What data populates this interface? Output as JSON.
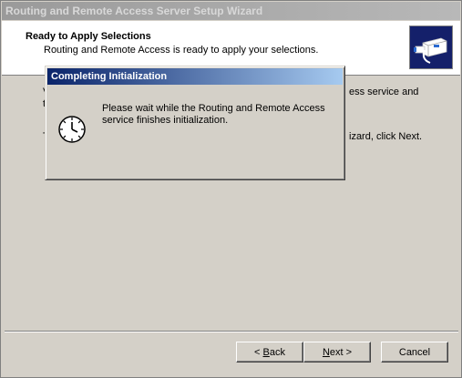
{
  "wizard": {
    "title": "Routing and Remote Access Server Setup Wizard",
    "header_title": "Ready to Apply Selections",
    "header_subtitle": "Routing and Remote Access is ready to apply your selections.",
    "body_fragments": [
      {
        "text": "V"
      },
      {
        "text": "t"
      },
      {
        "text": "T"
      },
      {
        "text": "ess service and"
      },
      {
        "text": "izard, click Next."
      }
    ],
    "buttons": {
      "back": {
        "acc": "B",
        "rest": "ack",
        "prefix": "< "
      },
      "next": {
        "acc": "N",
        "rest": "ext >"
      },
      "cancel": "Cancel"
    }
  },
  "popup": {
    "title": "Completing Initialization",
    "message": "Please wait while the Routing and Remote Access service finishes initialization."
  },
  "icons": {
    "wizard_icon": "network-cable-icon",
    "popup_icon": "clock-icon"
  },
  "colors": {
    "dialog_face": "#d4d0c8",
    "active_title": "#0a246a",
    "inactive_title": "#9a9a9a"
  }
}
